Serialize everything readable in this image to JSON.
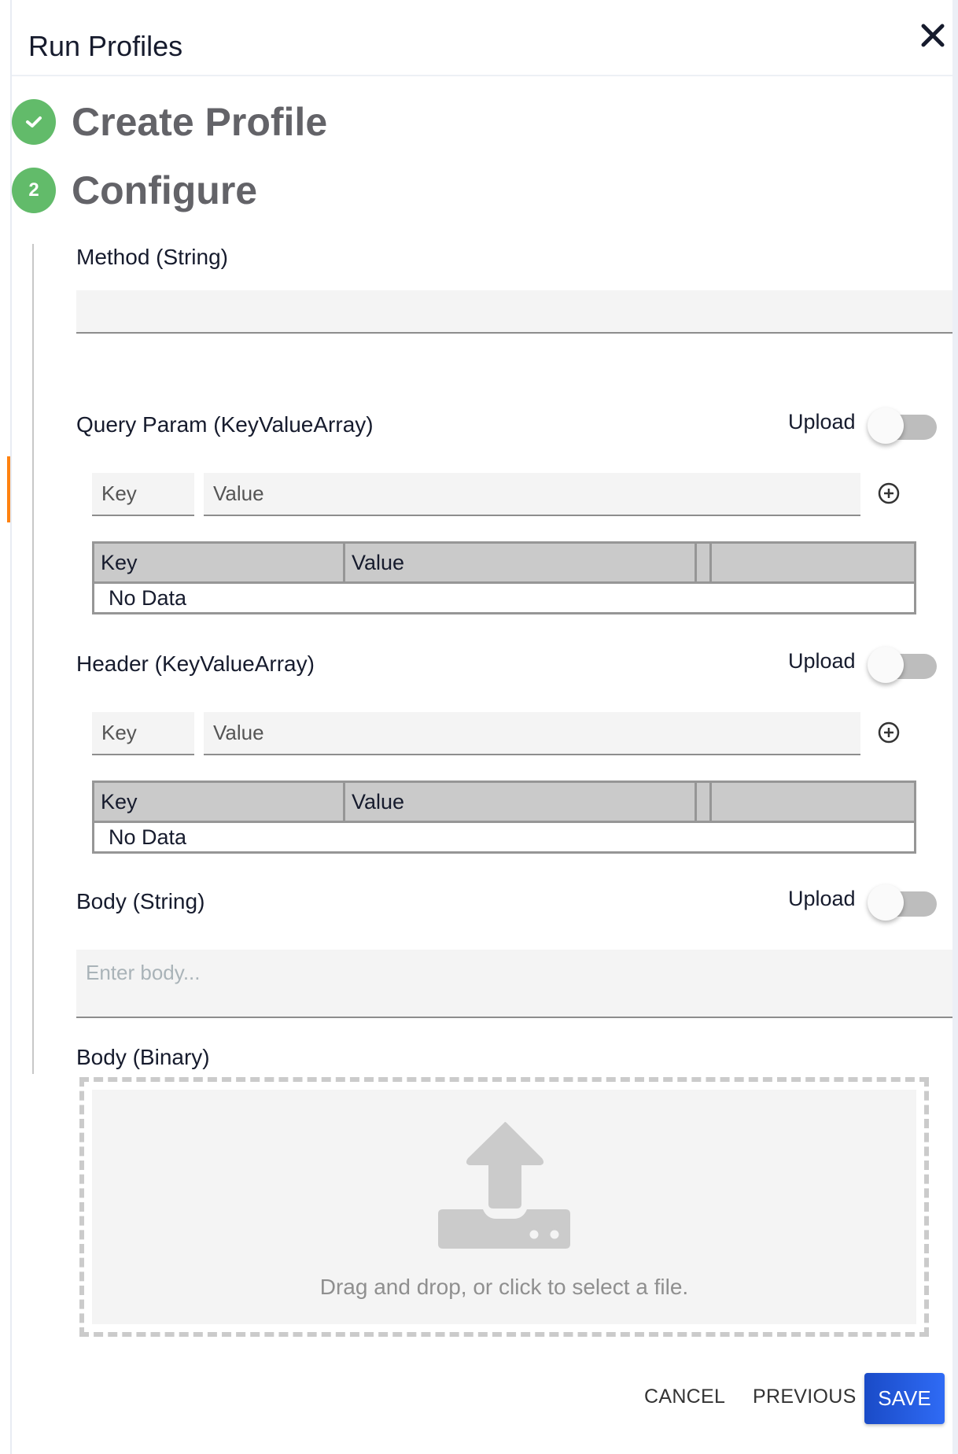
{
  "header": {
    "title": "Run Profiles",
    "close_icon": "close-icon"
  },
  "steps": [
    {
      "number": "1",
      "label": "Create Profile",
      "status": "completed",
      "icon": "check-icon"
    },
    {
      "number": "2",
      "label": "Configure",
      "status": "active"
    }
  ],
  "colors": {
    "step_green": "#62bb6a",
    "accent_orange": "#ff8210",
    "save_blue": "#1a4bc7"
  },
  "fields": {
    "method": {
      "label": "Method (String)",
      "value": ""
    },
    "query_param": {
      "label": "Query Param (KeyValueArray)",
      "upload_label": "Upload",
      "upload_enabled": false,
      "key_placeholder": "Key",
      "value_placeholder": "Value",
      "add_icon": "plus-circle-icon",
      "table": {
        "columns": [
          "Key",
          "Value",
          "",
          ""
        ],
        "empty_text": "No Data"
      }
    },
    "header": {
      "label": "Header (KeyValueArray)",
      "upload_label": "Upload",
      "upload_enabled": false,
      "key_placeholder": "Key",
      "value_placeholder": "Value",
      "add_icon": "plus-circle-icon",
      "table": {
        "columns": [
          "Key",
          "Value",
          "",
          ""
        ],
        "empty_text": "No Data"
      }
    },
    "body_string": {
      "label": "Body (String)",
      "upload_label": "Upload",
      "upload_enabled": false,
      "placeholder": "Enter body...",
      "value": ""
    },
    "body_binary": {
      "label": "Body (Binary)",
      "drop_text": "Drag and drop, or click to select a file.",
      "icon": "upload-icon"
    }
  },
  "footer": {
    "cancel_label": "CANCEL",
    "previous_label": "PREVIOUS",
    "save_label": "SAVE"
  }
}
